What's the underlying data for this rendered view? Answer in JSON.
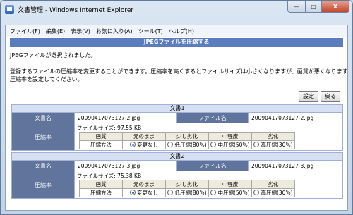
{
  "window": {
    "title": "文書管理 - Windows Internet Explorer",
    "min": "—",
    "max": "□",
    "close": "X"
  },
  "menu": [
    "ファイル(F)",
    "編集(E)",
    "表示(V)",
    "お気に入り(A)",
    "ツール(T)",
    "ヘルプ(H)"
  ],
  "page": {
    "header": "JPEGファイルを圧縮する",
    "selected_msg": "JPEGファイルが選択されました。",
    "instruction_line1": "登録するファイルの圧縮率を変更することができます。圧縮率を高くするとファイルサイズは小さくなりますが、画質が悪くなります。",
    "instruction_line2": "圧縮率を設定してください。",
    "buttons": {
      "settings": "設定",
      "back": "戻る"
    }
  },
  "labels": {
    "doc_name": "文書名",
    "file_name": "ファイル名",
    "compression": "圧縮率"
  },
  "documents": [
    {
      "title": "文書1",
      "doc_name": "20090417073127-2.jpg",
      "file_name": "20090417073127-2.jpg",
      "file_size": "ファイルサイズ: 97.55 KB",
      "quality_row": [
        "画質",
        "元のまま",
        "少し劣化",
        "中程度",
        "劣化"
      ],
      "method_row": [
        "圧縮方法",
        "変更なし",
        "低圧縮(80%)",
        "中圧縮(50%)",
        "高圧縮(30%)"
      ],
      "selected": 0
    },
    {
      "title": "文書2",
      "doc_name": "20090417073127-3.jpg",
      "file_name": "20090417073127-3.jpg",
      "file_size": "ファイルサイズ: 75.38 KB",
      "quality_row": [
        "画質",
        "元のまま",
        "少し劣化",
        "中程度",
        "劣化"
      ],
      "method_row": [
        "圧縮方法",
        "変更なし",
        "低圧縮(80%)",
        "中圧縮(50%)",
        "高圧縮(30%)"
      ],
      "selected": 0
    }
  ]
}
